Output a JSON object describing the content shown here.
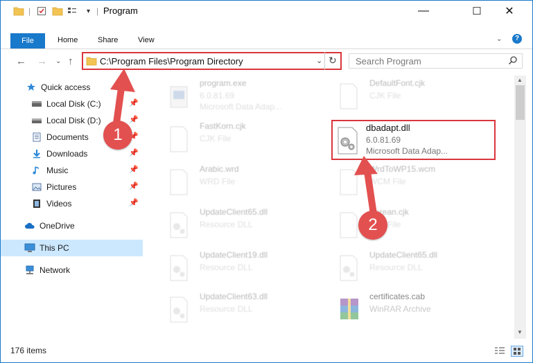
{
  "window": {
    "title": "Program",
    "minimize": "—",
    "maximize": "☐",
    "close": "✕",
    "help": "?"
  },
  "ribbon": {
    "tabs": [
      "File",
      "Home",
      "Share",
      "View"
    ]
  },
  "navigation": {
    "address": "C:\\Program Files\\Program Directory",
    "search_placeholder": "Search Program"
  },
  "sidebar": {
    "items": [
      {
        "label": "Quick access",
        "icon": "star-icon"
      },
      {
        "label": "Local Disk (C:)",
        "icon": "drive-icon",
        "pinned": true
      },
      {
        "label": "Local Disk (D:)",
        "icon": "drive-icon",
        "pinned": true
      },
      {
        "label": "Documents",
        "icon": "documents-icon",
        "pinned": true
      },
      {
        "label": "Downloads",
        "icon": "download-icon",
        "pinned": true
      },
      {
        "label": "Music",
        "icon": "music-icon",
        "pinned": true
      },
      {
        "label": "Pictures",
        "icon": "pictures-icon",
        "pinned": true
      },
      {
        "label": "Videos",
        "icon": "videos-icon",
        "pinned": true
      },
      {
        "label": "OneDrive",
        "icon": "cloud-icon"
      },
      {
        "label": "This PC",
        "icon": "computer-icon",
        "selected": true
      },
      {
        "label": "Network",
        "icon": "network-icon"
      }
    ]
  },
  "files": [
    {
      "name": "program.exe",
      "line1": "6.0.81.69",
      "line2": "Microsoft Data Adap...",
      "icon": "exe-icon"
    },
    {
      "name": "DefaultFont.cjk",
      "line1": "CJK File",
      "line2": "",
      "icon": "blank-file-icon"
    },
    {
      "name": "FastKorn.cjk",
      "line1": "CJK File",
      "line2": "",
      "icon": "blank-file-icon"
    },
    {
      "name": "dbadapt.dll",
      "line1": "6.0.81.69",
      "line2": "Microsoft Data Adap...",
      "icon": "dll-gear-icon",
      "highlighted": true
    },
    {
      "name": "Arabic.wrd",
      "line1": "WRD File",
      "line2": "",
      "icon": "blank-file-icon"
    },
    {
      "name": "WrdToWP15.wcm",
      "line1": "WCM File",
      "line2": "",
      "icon": "blank-file-icon"
    },
    {
      "name": "UpdateClient65.dll",
      "line1": "Resource DLL",
      "line2": "",
      "icon": "dll-gear-icon"
    },
    {
      "name": "Korean.cjk",
      "line1": "CJK File",
      "line2": "",
      "icon": "blank-file-icon"
    },
    {
      "name": "UpdateClient19.dll",
      "line1": "Resource DLL",
      "line2": "",
      "icon": "dll-gear-icon"
    },
    {
      "name": "UpdateClient65.dll",
      "line1": "Resource DLL",
      "line2": "",
      "icon": "dll-gear-icon"
    },
    {
      "name": "UpdateClient63.dll",
      "line1": "Resource DLL",
      "line2": "",
      "icon": "dll-gear-icon"
    },
    {
      "name": "certificates.cab",
      "line1": "WinRAR Archive",
      "line2": "",
      "icon": "winrar-icon"
    }
  ],
  "annotations": {
    "step1": "1",
    "step2": "2",
    "color": "#d9353b"
  },
  "status": {
    "count": "176 items"
  }
}
